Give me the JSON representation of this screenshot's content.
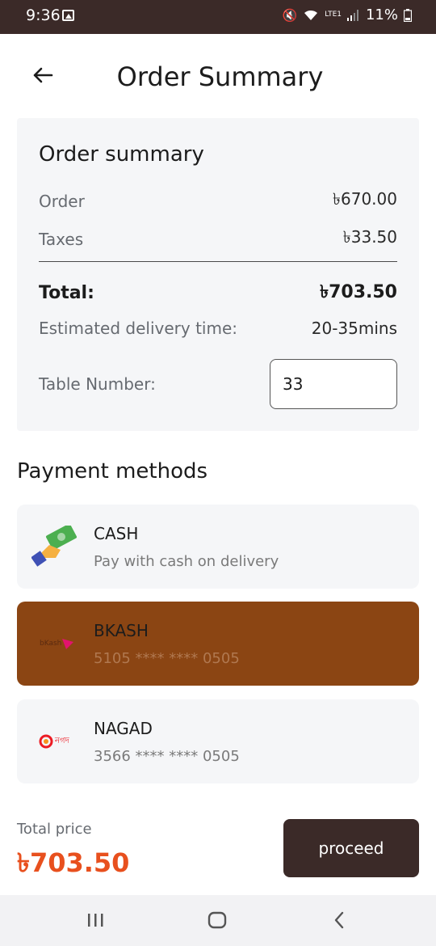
{
  "status": {
    "time": "9:36",
    "battery": "11%",
    "network": "LTE1"
  },
  "header": {
    "title": "Order Summary"
  },
  "summary": {
    "title": "Order summary",
    "order_label": "Order",
    "order_value": "৳670.00",
    "taxes_label": "Taxes",
    "taxes_value": "৳33.50",
    "total_label": "Total:",
    "total_value": "৳703.50",
    "delivery_label": "Estimated delivery time:",
    "delivery_value": "20-35mins",
    "table_label": "Table Number:",
    "table_value": "33"
  },
  "payment": {
    "title": "Payment methods",
    "methods": [
      {
        "name": "CASH",
        "detail": "Pay with cash on delivery",
        "selected": false,
        "icon": "cash-hand-icon"
      },
      {
        "name": "BKASH",
        "detail": "5105 **** **** 0505",
        "selected": true,
        "icon": "bkash-logo",
        "logo_text": "bKash"
      },
      {
        "name": "NAGAD",
        "detail": "3566 **** **** 0505",
        "selected": false,
        "icon": "nagad-logo",
        "logo_text": "নগদ"
      }
    ]
  },
  "footer": {
    "total_label": "Total price",
    "total_value": "৳703.50",
    "proceed_label": "proceed"
  },
  "colors": {
    "accent": "#e8501e",
    "dark": "#3b2a28",
    "selected": "#8b4513",
    "card": "#f5f6f8"
  }
}
